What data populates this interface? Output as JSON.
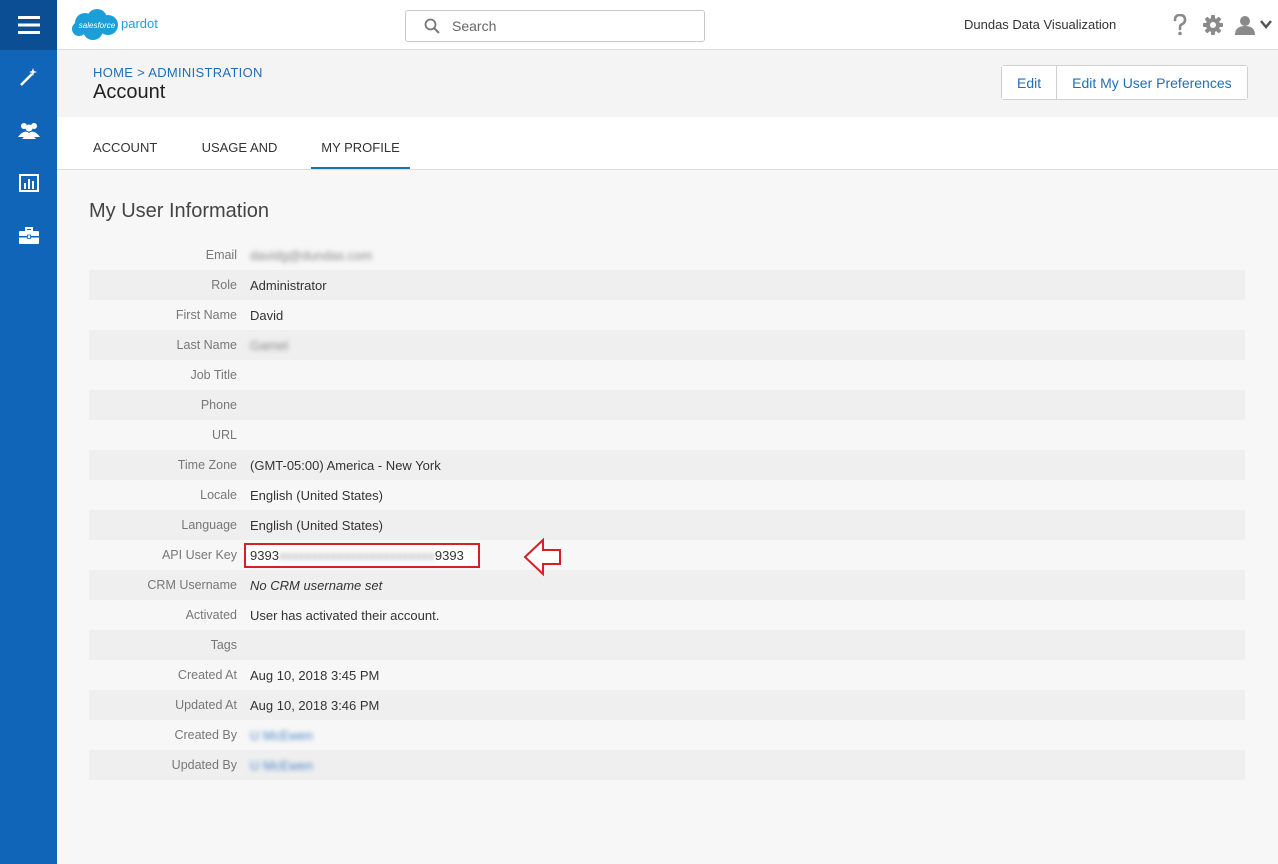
{
  "header": {
    "logo_cloud_text": "salesforce",
    "logo_product": "pardot",
    "search_placeholder": "Search",
    "org_name": "Dundas Data Visualization"
  },
  "page": {
    "breadcrumb_home": "HOME",
    "breadcrumb_sep": ">",
    "breadcrumb_admin": "ADMINISTRATION",
    "title": "Account",
    "buttons": {
      "edit": "Edit",
      "edit_prefs": "Edit My User Preferences"
    }
  },
  "tabs": [
    {
      "label": "ACCOUNT",
      "active": false
    },
    {
      "label": "USAGE AND LIMITS",
      "active": false
    },
    {
      "label": "MY PROFILE",
      "active": true
    }
  ],
  "profile": {
    "section_title": "My User Information",
    "rows": [
      {
        "label": "Email",
        "value": "davidg@dundas.com",
        "blurred": true
      },
      {
        "label": "Role",
        "value": "Administrator"
      },
      {
        "label": "First Name",
        "value": "David"
      },
      {
        "label": "Last Name",
        "value": "Gamel",
        "blurred": true
      },
      {
        "label": "Job Title",
        "value": ""
      },
      {
        "label": "Phone",
        "value": ""
      },
      {
        "label": "URL",
        "value": ""
      },
      {
        "label": "Time Zone",
        "value": "(GMT-05:00) America - New York"
      },
      {
        "label": "Locale",
        "value": "English (United States)"
      },
      {
        "label": "Language",
        "value": "English (United States)"
      },
      {
        "label": "API User Key",
        "value_start": "9393",
        "value_mid": "xxxxxxxxxxxxxxxxxxxxxxxx",
        "value_end": "9393"
      },
      {
        "label": "CRM Username",
        "value": "No CRM username set",
        "italic": true
      },
      {
        "label": "Activated",
        "value": "User has activated their account."
      },
      {
        "label": "Tags",
        "value": ""
      },
      {
        "label": "Created At",
        "value": "Aug 10, 2018 3:45 PM"
      },
      {
        "label": "Updated At",
        "value": "Aug 10, 2018 3:46 PM"
      },
      {
        "label": "Created By",
        "value": "U McEwen",
        "blurred": true,
        "link": true
      },
      {
        "label": "Updated By",
        "value": "U McEwen",
        "blurred": true,
        "link": true
      }
    ]
  },
  "colors": {
    "nav": "#1065b8",
    "nav_dark": "#0b4e93",
    "accent": "#1f6fb8",
    "highlight": "#d61f26"
  },
  "icons": [
    "menu-icon",
    "wand-icon",
    "users-icon",
    "chart-icon",
    "briefcase-icon",
    "search-icon",
    "help-icon",
    "gear-icon",
    "user-icon",
    "chevron-down-icon",
    "arrow-left-icon"
  ]
}
